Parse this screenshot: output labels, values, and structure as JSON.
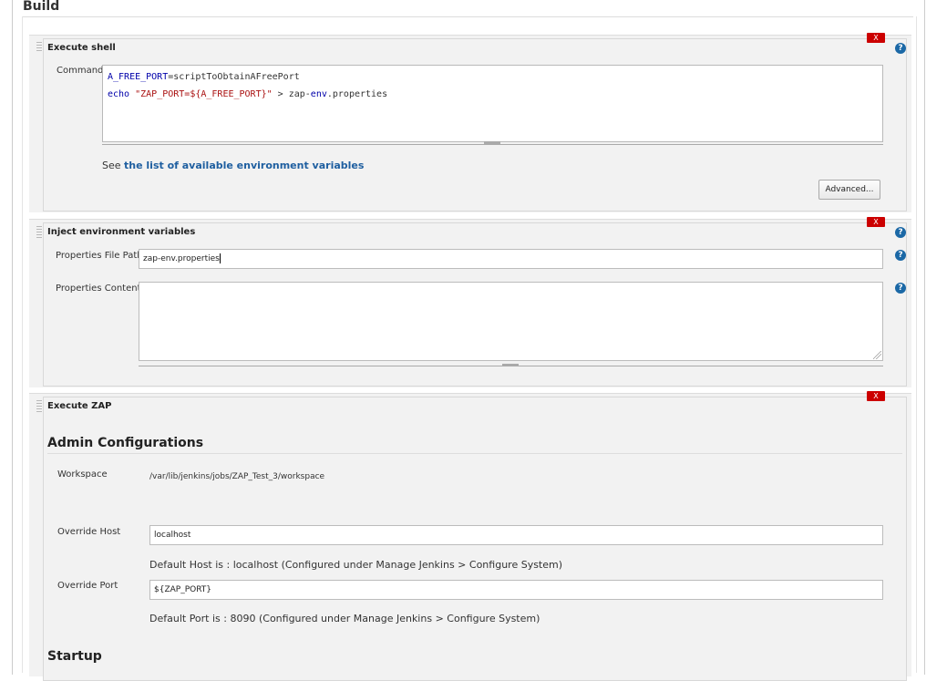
{
  "build": {
    "title": "Build"
  },
  "shell_step": {
    "title": "Execute shell",
    "delete_label": "X",
    "help_icon": "?",
    "command_label": "Command",
    "command_lines": [
      {
        "var": "A_FREE_PORT",
        "op": "=",
        "rest": "scriptToObtainAFreePort"
      },
      {
        "kw": "echo",
        "str": "\"ZAP_PORT=${A_FREE_PORT}\"",
        "rest": " > zap-",
        "env": "env",
        "tail": ".properties"
      }
    ],
    "see_prefix": "See",
    "env_link": "the list of available environment variables",
    "advanced_label": "Advanced..."
  },
  "inject_step": {
    "title": "Inject environment variables",
    "delete_label": "X",
    "help_icon": "?",
    "file_path_label": "Properties File Path",
    "file_path_value": "zap-env.properties",
    "content_label": "Properties Content",
    "content_value": ""
  },
  "zap_step": {
    "title": "Execute ZAP",
    "delete_label": "X",
    "admin_heading": "Admin Configurations",
    "workspace_label": "Workspace",
    "workspace_value": "/var/lib/jenkins/jobs/ZAP_Test_3/workspace",
    "override_host_label": "Override Host",
    "override_host_value": "localhost",
    "default_host_hint": "Default Host is : localhost (Configured under Manage Jenkins > Configure System)",
    "override_port_label": "Override Port",
    "override_port_value": "${ZAP_PORT}",
    "default_port_hint": "Default Port is : 8090 (Configured under Manage Jenkins > Configure System)",
    "startup_heading": "Startup"
  },
  "colors": {
    "delete": "#cc0000",
    "help": "#1b68a6",
    "link": "#1f5fa0"
  }
}
